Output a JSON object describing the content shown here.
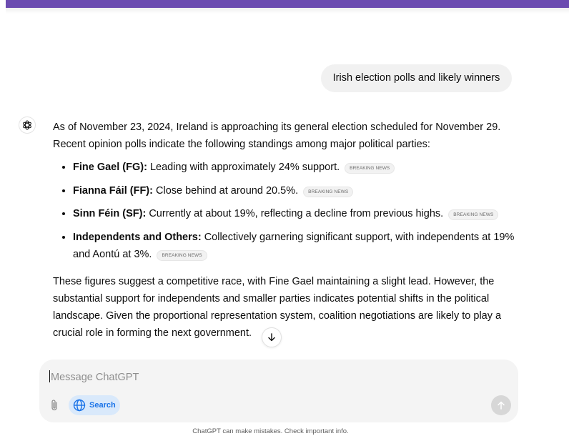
{
  "user_message": "Irish election polls and likely winners",
  "assistant": {
    "intro": "As of November 23, 2024, Ireland is approaching its general election scheduled for November 29. Recent opinion polls indicate the following standings among major political parties:",
    "bullets": [
      {
        "party": "Fine Gael (FG):",
        "text": " Leading with approximately 24% support.",
        "badge": "BREAKING NEWS"
      },
      {
        "party": "Fianna Fáil (FF):",
        "text": " Close behind at around 20.5%.",
        "badge": "BREAKING NEWS"
      },
      {
        "party": "Sinn Féin (SF):",
        "text": " Currently at about 19%, reflecting a decline from previous highs.",
        "badge": "BREAKING NEWS"
      },
      {
        "party": "Independents and Others:",
        "text": " Collectively garnering significant support, with independents at 19% and Aontú at 3%.",
        "badge": "BREAKING NEWS"
      }
    ],
    "conclusion": "These figures suggest a competitive race, with Fine Gael maintaining a slight lead. However, the substantial support for independents and smaller parties indicates potential shifts in the political landscape. Given the proportional representation system, coalition negotiations are likely to play a crucial role in forming the next government."
  },
  "composer": {
    "placeholder": "Message ChatGPT",
    "search_label": "Search"
  },
  "icons": {
    "avatar": "openai-logo-icon",
    "scroll": "arrow-down-icon",
    "attach": "paperclip-icon",
    "search": "globe-icon",
    "send": "arrow-up-icon"
  },
  "colors": {
    "top_bar": "#6b4bb0",
    "search_bg": "#d9e9fb",
    "search_fg": "#1a73e8"
  },
  "footer": {
    "disclaimer": "ChatGPT can make mistakes. Check important info."
  }
}
